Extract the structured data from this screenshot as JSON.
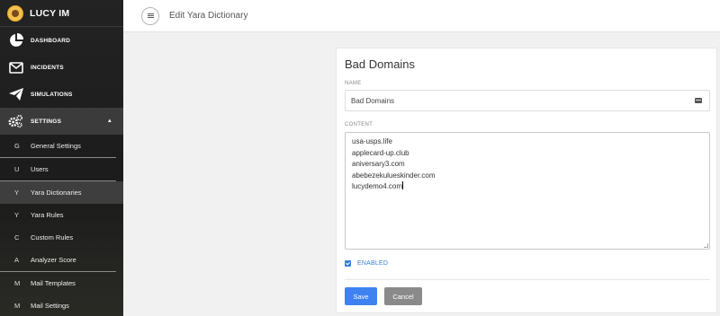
{
  "app": {
    "name": "LUCY IM"
  },
  "sidebar": {
    "main": [
      {
        "label": "DASHBOARD",
        "icon": "pie-chart-icon"
      },
      {
        "label": "INCIDENTS",
        "icon": "envelope-icon"
      },
      {
        "label": "SIMULATIONS",
        "icon": "paper-plane-icon"
      },
      {
        "label": "SETTINGS",
        "icon": "gears-icon"
      }
    ],
    "sub": [
      {
        "letter": "G",
        "label": "General Settings"
      },
      {
        "letter": "U",
        "label": "Users"
      },
      {
        "letter": "Y",
        "label": "Yara Dictionaries"
      },
      {
        "letter": "Y",
        "label": "Yara Rules"
      },
      {
        "letter": "C",
        "label": "Custom Rules"
      },
      {
        "letter": "A",
        "label": "Analyzer Score"
      },
      {
        "letter": "M",
        "label": "Mail Templates"
      },
      {
        "letter": "M",
        "label": "Mail Settings"
      }
    ]
  },
  "header": {
    "title": "Edit Yara Dictionary"
  },
  "form": {
    "title": "Bad Domains",
    "name_label": "NAME",
    "name_value": "Bad Domains",
    "content_label": "CONTENT",
    "content_lines": [
      "usa-usps.life",
      "applecard-up.club",
      "aniversary3.com",
      "abebezekulueskinder.com",
      "lucydemo4.com"
    ],
    "enabled_label": "ENABLED",
    "enabled": true,
    "save_label": "Save",
    "cancel_label": "Cancel"
  },
  "colors": {
    "accent": "#3e82f1",
    "sidebar_bg": "#1f1f1f",
    "cancel": "#8a8a8a"
  }
}
